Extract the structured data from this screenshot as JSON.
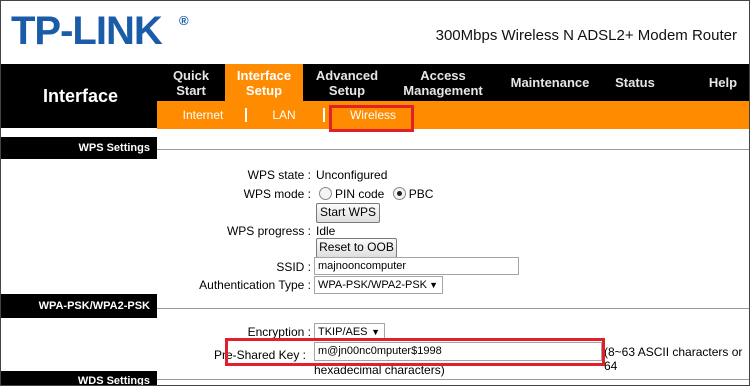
{
  "brand": {
    "logo": "TP-LINK",
    "reg": "®",
    "product": "300Mbps Wireless N ADSL2+ Modem Router"
  },
  "left": {
    "interface": "Interface",
    "wps_settings": "WPS Settings",
    "wpa_section": "WPA-PSK/WPA2-PSK",
    "wds_settings": "WDS Settings"
  },
  "nav": {
    "quick_start": [
      "Quick",
      "Start"
    ],
    "interface_setup": [
      "Interface",
      "Setup"
    ],
    "advanced_setup": [
      "Advanced",
      "Setup"
    ],
    "access_management": [
      "Access",
      "Management"
    ],
    "maintenance": "Maintenance",
    "status": "Status",
    "help": "Help"
  },
  "subnav": {
    "internet": "Internet",
    "lan": "LAN",
    "wireless": "Wireless"
  },
  "wps": {
    "state_label": "WPS state :",
    "state_value": "Unconfigured",
    "mode_label": "WPS mode :",
    "mode_pin": "PIN code",
    "mode_pbc": "PBC",
    "start_button": "Start WPS",
    "progress_label": "WPS progress :",
    "progress_value": "Idle",
    "reset_button": "Reset to OOB"
  },
  "ssid": {
    "label": "SSID :",
    "value": "majnooncomputer"
  },
  "auth": {
    "label": "Authentication Type :",
    "value": "WPA-PSK/WPA2-PSK"
  },
  "encryption": {
    "label": "Encryption :",
    "value": "TKIP/AES"
  },
  "psk": {
    "label": "Pre-Shared Key :",
    "value": "m@jn00nc0mputer$1998",
    "hint_1": "(8~63 ASCII characters or 64",
    "hint_2": "hexadecimal characters)"
  },
  "highlight_color": "#e0202a",
  "accent_color": "#ff8c00"
}
